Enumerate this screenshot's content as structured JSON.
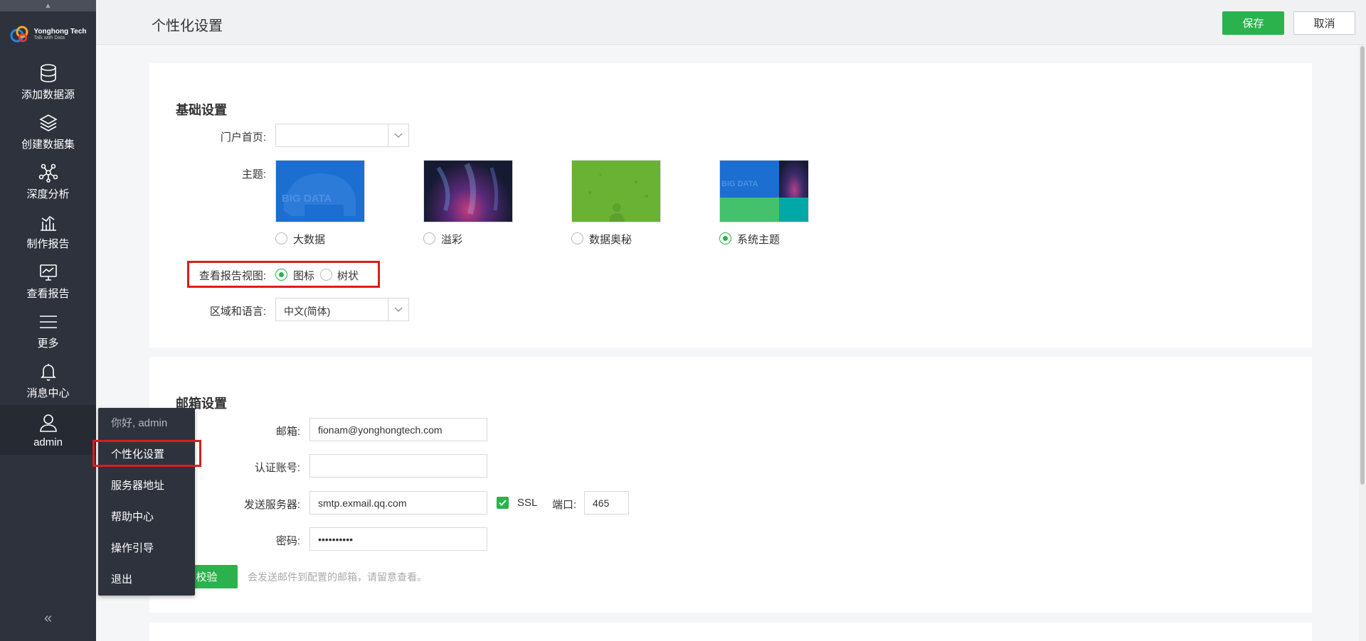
{
  "sidebar": {
    "logo": {
      "name": "Yonghong Tech",
      "tagline": "Talk with Data"
    },
    "items": [
      {
        "label": "添加数据源",
        "icon": "database-icon"
      },
      {
        "label": "创建数据集",
        "icon": "layers-icon"
      },
      {
        "label": "深度分析",
        "icon": "network-icon"
      },
      {
        "label": "制作报告",
        "icon": "bar-chart-icon"
      },
      {
        "label": "查看报告",
        "icon": "monitor-chart-icon"
      },
      {
        "label": "更多",
        "icon": "menu-icon"
      },
      {
        "label": "消息中心",
        "icon": "bell-icon"
      },
      {
        "label": "admin",
        "icon": "user-icon"
      }
    ]
  },
  "user_menu": {
    "greeting": "你好, admin",
    "items": [
      "个性化设置",
      "服务器地址",
      "帮助中心",
      "操作引导",
      "退出"
    ]
  },
  "header": {
    "title": "个性化设置",
    "save_label": "保存",
    "cancel_label": "取消"
  },
  "basic": {
    "title": "基础设置",
    "portal_label": "门户首页:",
    "portal_value": "",
    "theme_label": "主题:",
    "themes": [
      {
        "label": "大数据",
        "checked": false,
        "thumb_text": "BIG DATA"
      },
      {
        "label": "溢彩",
        "checked": false
      },
      {
        "label": "数据奥秘",
        "checked": false
      },
      {
        "label": "系统主题",
        "checked": true,
        "thumb_text": "BIG DATA"
      }
    ],
    "report_view_label": "查看报告视图:",
    "report_view_options": [
      "图标",
      "树状"
    ],
    "report_view_selected": "图标",
    "locale_label": "区域和语言:",
    "locale_value": "中文(简体)"
  },
  "mail": {
    "title": "邮箱设置",
    "email_label": "邮箱:",
    "email_value": "fionam@yonghongtech.com",
    "account_label": "认证账号:",
    "account_value": "",
    "server_label": "发送服务器:",
    "server_value": "smtp.exmail.qq.com",
    "ssl_label": "SSL",
    "ssl_checked": true,
    "port_label": "端口:",
    "port_value": "465",
    "password_label": "密码:",
    "password_value": "••••••••••",
    "verify_label": "校验",
    "hint": "会发送邮件到配置的邮箱，请留意查看。"
  },
  "colors": {
    "accent": "#2bb24c",
    "sidebar": "#2e323c",
    "highlight": "#d81e1e"
  }
}
